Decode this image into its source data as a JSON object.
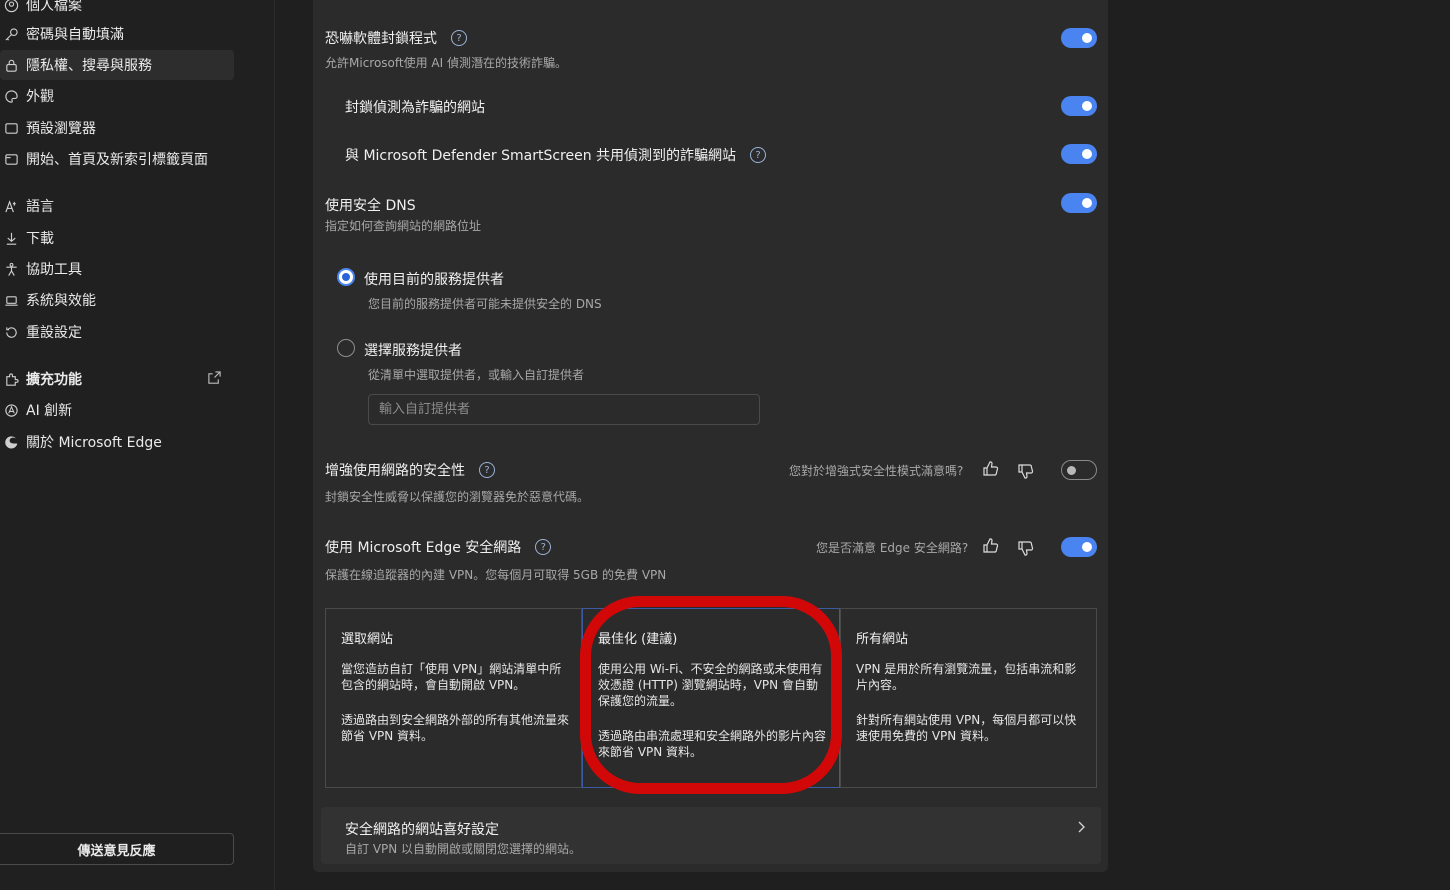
{
  "sidebar": {
    "items": [
      {
        "label": "個人檔案",
        "icon": "profile-icon"
      },
      {
        "label": "密碼與自動填滿",
        "icon": "key-icon"
      },
      {
        "label": "隱私權、搜尋與服務",
        "icon": "lock-icon"
      },
      {
        "label": "外觀",
        "icon": "palette-icon"
      },
      {
        "label": "預設瀏覽器",
        "icon": "browser-icon"
      },
      {
        "label": "開始、首頁及新索引標籤頁面",
        "icon": "home-tab-icon"
      },
      {
        "label": "語言",
        "icon": "language-icon"
      },
      {
        "label": "下載",
        "icon": "download-icon"
      },
      {
        "label": "協助工具",
        "icon": "accessibility-icon"
      },
      {
        "label": "系統與效能",
        "icon": "laptop-icon"
      },
      {
        "label": "重設設定",
        "icon": "reset-icon"
      },
      {
        "label": "擴充功能",
        "icon": "extensions-icon"
      },
      {
        "label": "AI 創新",
        "icon": "ai-icon"
      },
      {
        "label": "關於 Microsoft Edge",
        "icon": "edge-logo-icon"
      }
    ],
    "feedback": "傳送意見反應"
  },
  "settings": {
    "scareware": {
      "title": "恐嚇軟體封鎖程式",
      "desc": "允許Microsoft使用 AI 偵測潛在的技術詐騙。",
      "on": true
    },
    "block_scam": {
      "title": "封鎖偵測為詐騙的網站",
      "on": true
    },
    "share_smartscreen": {
      "title": "與 Microsoft Defender SmartScreen 共用偵測到的詐騙網站",
      "on": true
    },
    "secure_dns": {
      "title": "使用安全 DNS",
      "desc": "指定如何查詢網站的網路位址",
      "on": true
    },
    "dns_current": {
      "label": "使用目前的服務提供者",
      "desc": "您目前的服務提供者可能未提供安全的 DNS",
      "selected": true
    },
    "dns_choose": {
      "label": "選擇服務提供者",
      "desc": "從清單中選取提供者，或輸入自訂提供者",
      "selected": false,
      "placeholder": "輸入自訂提供者"
    },
    "enhanced_security": {
      "title": "增強使用網路的安全性",
      "desc": "封鎖安全性威脅以保護您的瀏覽器免於惡意代碼。",
      "question": "您對於增強式安全性模式滿意嗎?",
      "on": false
    },
    "secure_network": {
      "title": "使用 Microsoft Edge 安全網路",
      "desc": "保護在線追蹤器的內建 VPN。您每個月可取得 5GB 的免費 VPN",
      "question": "您是否滿意 Edge 安全網路?",
      "on": true
    }
  },
  "vpn_cards": [
    {
      "title": "選取網站",
      "p1": "當您造訪自訂「使用 VPN」網站清單中所包含的網站時，會自動開啟 VPN。",
      "p2": "透過路由到安全網路外部的所有其他流量來節省 VPN 資料。"
    },
    {
      "title": "最佳化 (建議)",
      "p1": "使用公用 Wi-Fi、不安全的網路或未使用有效憑證 (HTTP) 瀏覽網站時，VPN 會自動保護您的流量。",
      "p2": "透過路由串流處理和安全網路外的影片內容來節省 VPN 資料。"
    },
    {
      "title": "所有網站",
      "p1": "VPN 是用於所有瀏覽流量，包括串流和影片內容。",
      "p2": "針對所有網站使用 VPN，每個月都可以快速使用免費的 VPN 資料。"
    }
  ],
  "pref_row": {
    "title": "安全網路的網站喜好設定",
    "desc": "自訂 VPN 以自動開啟或關閉您選擇的網站。"
  },
  "colors": {
    "accent": "#4a84f0",
    "highlight": "#d20808",
    "panel": "#2b2b2b"
  }
}
